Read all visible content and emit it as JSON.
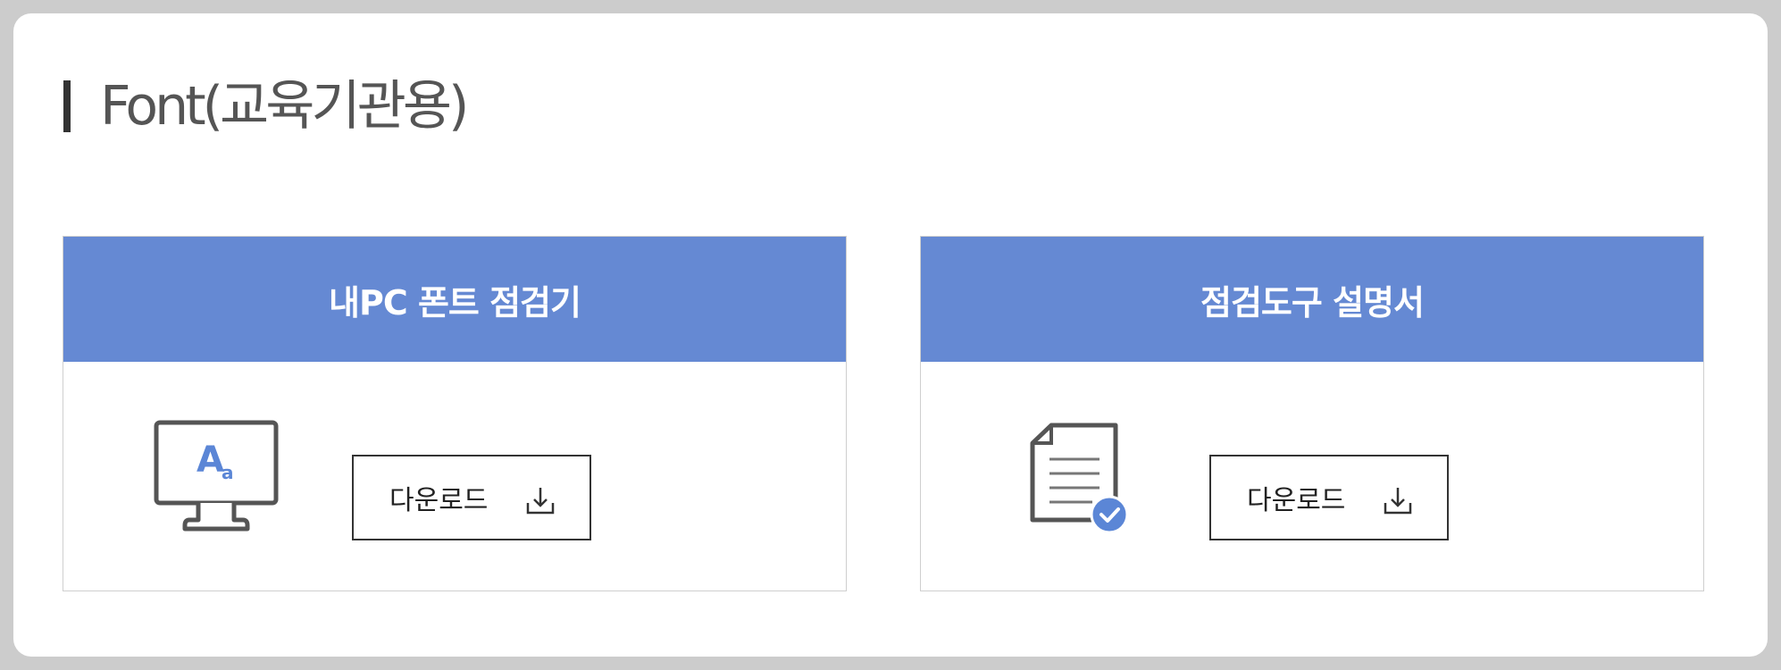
{
  "section": {
    "title": "Font(교육기관용)"
  },
  "cards": [
    {
      "header": "내PC 폰트 점검기",
      "icon": "monitor-font-icon",
      "icon_text": "A",
      "icon_subtext": "a",
      "button_label": "다운로드",
      "button_icon": "download-icon"
    },
    {
      "header": "점검도구 설명서",
      "icon": "document-check-icon",
      "button_label": "다운로드",
      "button_icon": "download-icon"
    }
  ],
  "colors": {
    "accent": "#6589d3",
    "page_bg": "#cccccc",
    "panel_bg": "#ffffff",
    "title_text": "#555555",
    "icon_gray": "#555555",
    "icon_blue": "#5b86d6"
  }
}
